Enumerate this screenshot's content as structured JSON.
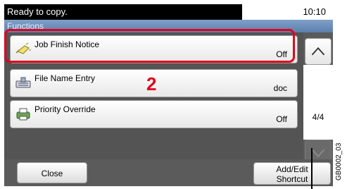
{
  "status": {
    "message": "Ready to copy.",
    "time": "10:10"
  },
  "section_title": "Functions",
  "rows": [
    {
      "label": "Job Finish Notice",
      "value": "Off",
      "icon": "bell-icon"
    },
    {
      "label": "File Name Entry",
      "value": "doc",
      "icon": "keyboard-icon"
    },
    {
      "label": "Priority Override",
      "value": "Off",
      "icon": "printer-icon"
    }
  ],
  "pagination": {
    "indicator": "4/4"
  },
  "callout": {
    "number": "2"
  },
  "buttons": {
    "close": "Close",
    "add_edit_line1": "Add/Edit",
    "add_edit_line2": "Shortcut"
  },
  "figure_code": "GB0002_03",
  "colors": {
    "highlight": "#e2001a",
    "accent_bar": "#5b7fad"
  }
}
